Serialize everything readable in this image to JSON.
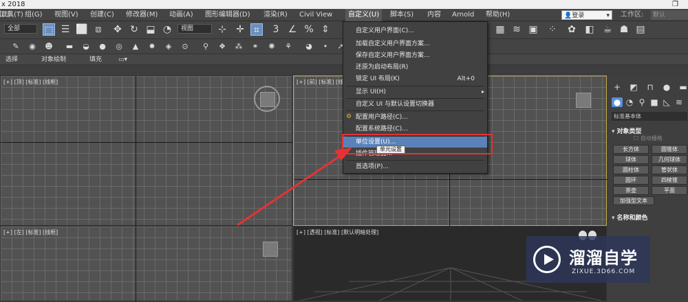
{
  "titlebar": {
    "title": "x 2018",
    "restore_glyph": "❐"
  },
  "menubar": {
    "items": [
      {
        "label": "编辑(E)"
      },
      {
        "label": "工具(T)"
      },
      {
        "label": "组(G)"
      },
      {
        "label": "视图(V)"
      },
      {
        "label": "创建(C)"
      },
      {
        "label": "修改器(M)"
      },
      {
        "label": "动画(A)"
      },
      {
        "label": "图形编辑器(D)"
      },
      {
        "label": "渲染(R)"
      },
      {
        "label": "Civil View"
      },
      {
        "label": "自定义(U)"
      },
      {
        "label": "脚本(S)"
      },
      {
        "label": "内容"
      },
      {
        "label": "Arnold"
      },
      {
        "label": "帮助(H)"
      }
    ],
    "login": "登录",
    "workspace_label": "工作区:",
    "workspace_value": "默认"
  },
  "toolbar": {
    "select_filter": "全部",
    "view_ref": "视图",
    "icons": [
      "undo-icon",
      "select-icon",
      "select-by-name-icon",
      "rect-region-icon",
      "window-crossing-icon",
      "move-icon",
      "rotate-icon",
      "scale-icon",
      "place-icon"
    ]
  },
  "ribbon_tabs": [
    {
      "label": "选择"
    },
    {
      "label": "对象绘制"
    },
    {
      "label": "填充"
    }
  ],
  "viewports": {
    "top_left_label": "[+] [顶] [标准] [线框]",
    "top_right_label": "[+] [前] [标准] [线框]",
    "bottom_left_label": "[+] [左] [标准] [线框]",
    "bottom_right_label": "[+] [透视] [标准] [默认明暗处理]"
  },
  "customize_menu": {
    "items": [
      {
        "label": "自定义用户界面(C)...",
        "shortcut": ""
      },
      {
        "label": "加载自定义用户界面方案...",
        "shortcut": ""
      },
      {
        "label": "保存自定义用户界面方案...",
        "shortcut": ""
      },
      {
        "label": "还原为启动布局(R)",
        "shortcut": ""
      },
      {
        "label": "锁定 UI 布局(K)",
        "shortcut": "Alt+0"
      },
      {
        "label": "显示 UI(H)",
        "shortcut": ""
      },
      {
        "label": "自定义 UI 与默认设置切换器",
        "shortcut": ""
      },
      {
        "label": "配置用户路径(C)...",
        "shortcut": ""
      },
      {
        "label": "配置系统路径(C)...",
        "shortcut": ""
      },
      {
        "label": "单位设置(U)...",
        "shortcut": ""
      },
      {
        "label": "插件管理器...",
        "shortcut": ""
      },
      {
        "label": "首选项(P)...",
        "shortcut": ""
      }
    ],
    "submenu_arrow": "▸",
    "highlighted": "单位设置(U)..."
  },
  "tooltip": "单元设置",
  "command_panel": {
    "dropdown": "标准基本体",
    "object_type_title": "对象类型",
    "autogrid": "自动栅格",
    "buttons": [
      "长方体",
      "圆锥体",
      "球体",
      "几何球体",
      "圆柱体",
      "管状体",
      "圆环",
      "四棱锥",
      "茶壶",
      "平面",
      "加强型文本"
    ],
    "name_color_title": "名称和颜色"
  },
  "watermark": {
    "brand": "溜溜自学",
    "url": "ZIXUE.3D66.COM"
  },
  "colors": {
    "highlight_blue": "#5b81b8",
    "annotation_red": "#e53333",
    "watermark_bg": "#2d375a"
  }
}
